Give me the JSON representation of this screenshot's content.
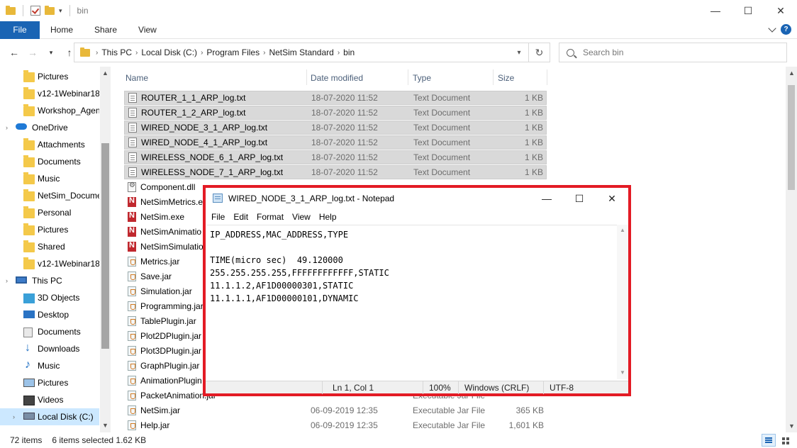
{
  "explorer": {
    "title": "bin",
    "ribbon": {
      "file": "File",
      "tabs": [
        "Home",
        "Share",
        "View"
      ],
      "help": "?"
    },
    "address": {
      "crumbs": [
        "This PC",
        "Local Disk (C:)",
        "Program Files",
        "NetSim Standard",
        "bin"
      ],
      "search_placeholder": "Search bin"
    },
    "sidebar": [
      {
        "label": "Pictures",
        "icon": "folder-icon"
      },
      {
        "label": "v12-1Webinar18",
        "icon": "folder-icon"
      },
      {
        "label": "Workshop_Agen",
        "icon": "folder-icon"
      },
      {
        "label": "OneDrive",
        "icon": "onedrive-icon"
      },
      {
        "label": "Attachments",
        "icon": "folder-icon"
      },
      {
        "label": "Documents",
        "icon": "folder-icon"
      },
      {
        "label": "Music",
        "icon": "folder-icon"
      },
      {
        "label": "NetSim_Docume",
        "icon": "folder-icon"
      },
      {
        "label": "Personal",
        "icon": "folder-icon"
      },
      {
        "label": "Pictures",
        "icon": "folder-icon"
      },
      {
        "label": "Shared",
        "icon": "folder-icon"
      },
      {
        "label": "v12-1Webinar18",
        "icon": "folder-icon"
      },
      {
        "label": "This PC",
        "icon": "pc-icon"
      },
      {
        "label": "3D Objects",
        "icon": "3d-objects-icon"
      },
      {
        "label": "Desktop",
        "icon": "desktop-icon"
      },
      {
        "label": "Documents",
        "icon": "documents-icon"
      },
      {
        "label": "Downloads",
        "icon": "downloads-icon"
      },
      {
        "label": "Music",
        "icon": "music-icon"
      },
      {
        "label": "Pictures",
        "icon": "pictures-icon"
      },
      {
        "label": "Videos",
        "icon": "videos-icon"
      },
      {
        "label": "Local Disk (C:)",
        "icon": "disk-icon"
      }
    ],
    "columns": {
      "name": "Name",
      "date": "Date modified",
      "type": "Type",
      "size": "Size"
    },
    "files": [
      {
        "name": "ROUTER_1_1_ARP_log.txt",
        "date": "18-07-2020 11:52",
        "type": "Text Document",
        "size": "1 KB",
        "icon": "text-file-icon",
        "selected": true
      },
      {
        "name": "ROUTER_1_2_ARP_log.txt",
        "date": "18-07-2020 11:52",
        "type": "Text Document",
        "size": "1 KB",
        "icon": "text-file-icon",
        "selected": true
      },
      {
        "name": "WIRED_NODE_3_1_ARP_log.txt",
        "date": "18-07-2020 11:52",
        "type": "Text Document",
        "size": "1 KB",
        "icon": "text-file-icon",
        "selected": true
      },
      {
        "name": "WIRED_NODE_4_1_ARP_log.txt",
        "date": "18-07-2020 11:52",
        "type": "Text Document",
        "size": "1 KB",
        "icon": "text-file-icon",
        "selected": true
      },
      {
        "name": "WIRELESS_NODE_6_1_ARP_log.txt",
        "date": "18-07-2020 11:52",
        "type": "Text Document",
        "size": "1 KB",
        "icon": "text-file-icon",
        "selected": true
      },
      {
        "name": "WIRELESS_NODE_7_1_ARP_log.txt",
        "date": "18-07-2020 11:52",
        "type": "Text Document",
        "size": "1 KB",
        "icon": "text-file-icon",
        "selected": true
      },
      {
        "name": "Component.dll",
        "date": "",
        "type": "",
        "size": "",
        "icon": "dll-file-icon",
        "selected": false
      },
      {
        "name": "NetSimMetrics.e",
        "date": "",
        "type": "",
        "size": "",
        "icon": "netsim-exe-icon",
        "selected": false
      },
      {
        "name": "NetSim.exe",
        "date": "",
        "type": "",
        "size": "",
        "icon": "netsim-exe-icon",
        "selected": false
      },
      {
        "name": "NetSimAnimatio",
        "date": "",
        "type": "",
        "size": "",
        "icon": "netsim-exe-icon",
        "selected": false
      },
      {
        "name": "NetSimSimulatio",
        "date": "",
        "type": "",
        "size": "",
        "icon": "netsim-exe-icon",
        "selected": false
      },
      {
        "name": "Metrics.jar",
        "date": "",
        "type": "",
        "size": "",
        "icon": "jar-file-icon",
        "selected": false
      },
      {
        "name": "Save.jar",
        "date": "",
        "type": "",
        "size": "",
        "icon": "jar-file-icon",
        "selected": false
      },
      {
        "name": "Simulation.jar",
        "date": "",
        "type": "",
        "size": "",
        "icon": "jar-file-icon",
        "selected": false
      },
      {
        "name": "Programming.jar",
        "date": "",
        "type": "",
        "size": "",
        "icon": "jar-file-icon",
        "selected": false
      },
      {
        "name": "TablePlugin.jar",
        "date": "",
        "type": "",
        "size": "",
        "icon": "jar-file-icon",
        "selected": false
      },
      {
        "name": "Plot2DPlugin.jar",
        "date": "",
        "type": "",
        "size": "",
        "icon": "jar-file-icon",
        "selected": false
      },
      {
        "name": "Plot3DPlugin.jar",
        "date": "",
        "type": "",
        "size": "",
        "icon": "jar-file-icon",
        "selected": false
      },
      {
        "name": "GraphPlugin.jar",
        "date": "",
        "type": "",
        "size": "",
        "icon": "jar-file-icon",
        "selected": false
      },
      {
        "name": "AnimationPlugin",
        "date": "",
        "type": "",
        "size": "",
        "icon": "jar-file-icon",
        "selected": false
      },
      {
        "name": "PacketAnimation.jar",
        "date": "",
        "type": "Executable Jar File",
        "size": "",
        "icon": "jar-file-icon",
        "selected": false
      },
      {
        "name": "NetSim.jar",
        "date": "06-09-2019 12:35",
        "type": "Executable Jar File",
        "size": "365 KB",
        "icon": "jar-file-icon",
        "selected": false
      },
      {
        "name": "Help.jar",
        "date": "06-09-2019 12:35",
        "type": "Executable Jar File",
        "size": "1,601 KB",
        "icon": "jar-file-icon",
        "selected": false
      }
    ],
    "status": {
      "items": "72 items",
      "selected": "6 items selected  1.62 KB"
    }
  },
  "notepad": {
    "title": "WIRED_NODE_3_1_ARP_log.txt - Notepad",
    "menu": [
      "File",
      "Edit",
      "Format",
      "View",
      "Help"
    ],
    "content": "IP_ADDRESS,MAC_ADDRESS,TYPE\n\nTIME(micro sec)  49.120000\n255.255.255.255,FFFFFFFFFFFF,STATIC\n11.1.1.2,AF1D00000301,STATIC\n11.1.1.1,AF1D00000101,DYNAMIC",
    "status": {
      "position": "Ln 1, Col 1",
      "zoom": "100%",
      "eol": "Windows (CRLF)",
      "encoding": "UTF-8"
    }
  },
  "colors": {
    "accent": "#1a64b4",
    "highlight": "#e31b25",
    "selection": "#d9d9d9"
  }
}
